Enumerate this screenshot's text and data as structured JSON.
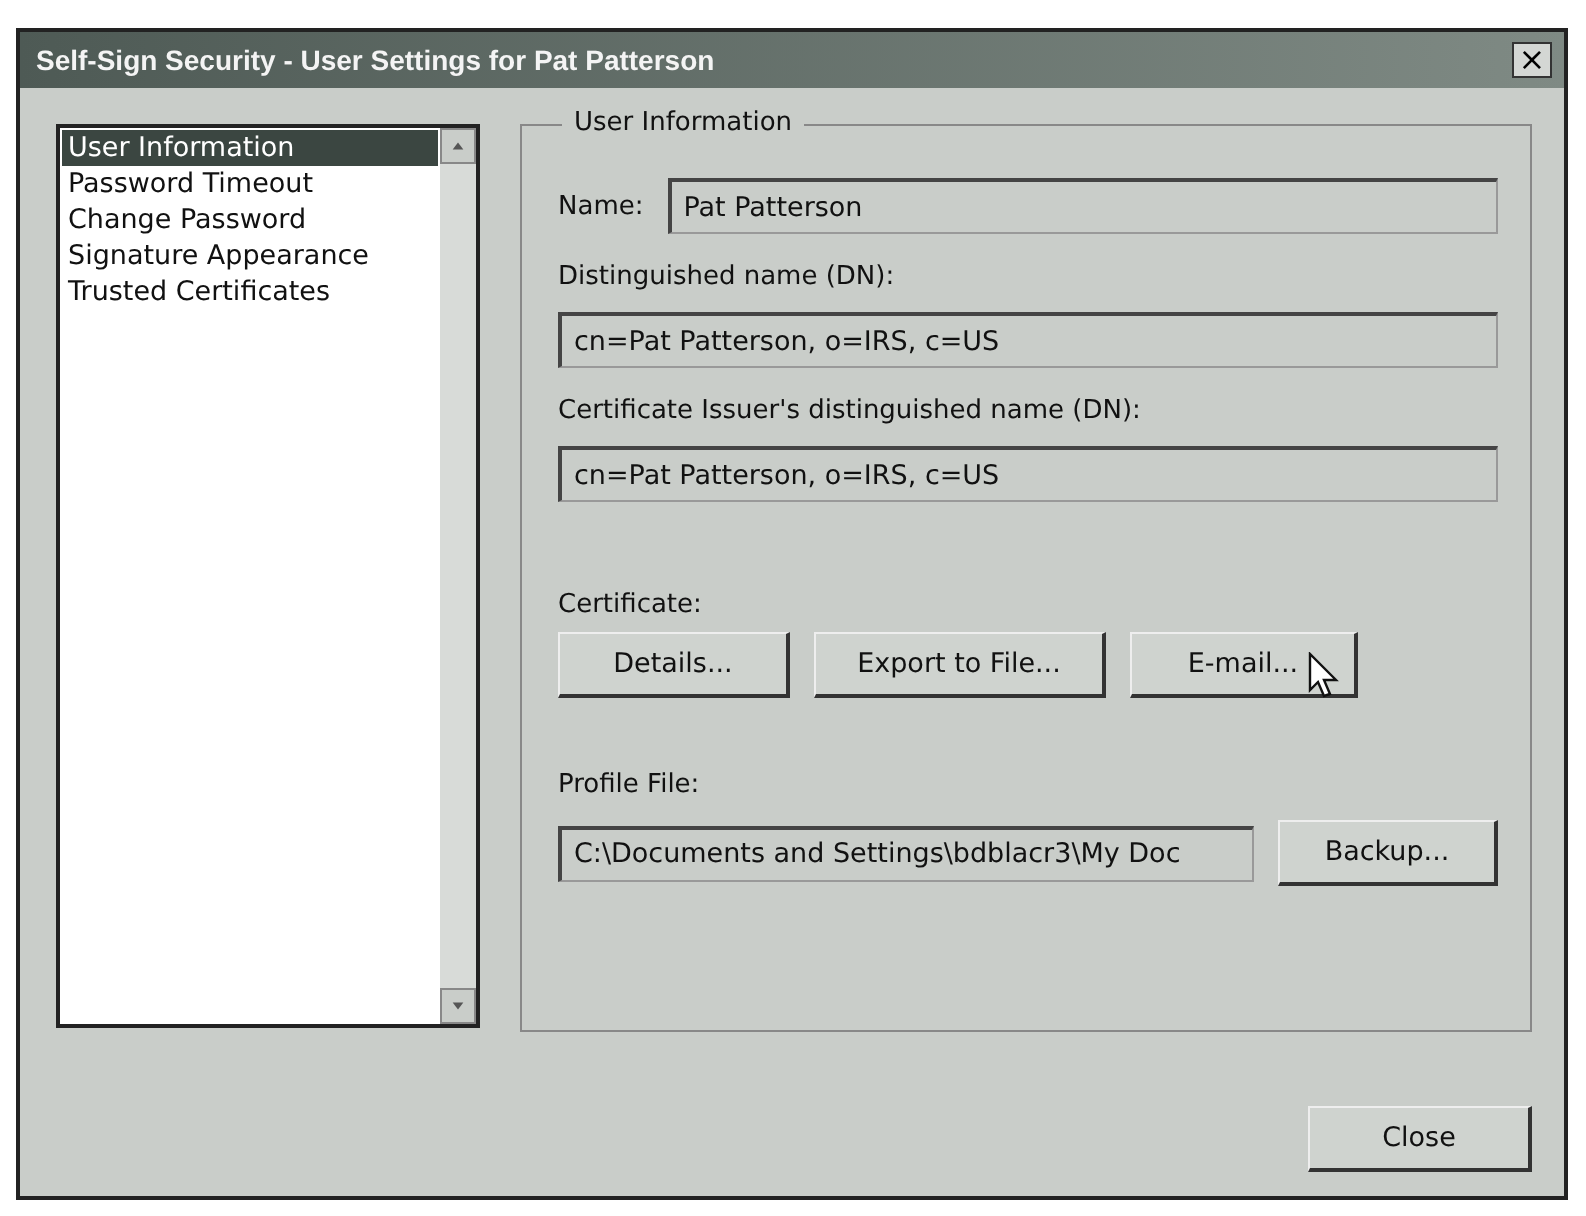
{
  "window": {
    "title": "Self-Sign Security - User Settings for Pat Patterson",
    "close_glyph": "×"
  },
  "sidebar": {
    "items": [
      {
        "label": "User Information",
        "selected": true
      },
      {
        "label": "Password Timeout",
        "selected": false
      },
      {
        "label": "Change Password",
        "selected": false
      },
      {
        "label": "Signature Appearance",
        "selected": false
      },
      {
        "label": "Trusted Certificates",
        "selected": false
      }
    ]
  },
  "group": {
    "title": "User Information",
    "name_label": "Name:",
    "name_value": "Pat Patterson",
    "dn_label": "Distinguished name (DN):",
    "dn_value": "cn=Pat Patterson, o=IRS, c=US",
    "issuer_label": "Certificate Issuer's distinguished name (DN):",
    "issuer_value": "cn=Pat Patterson, o=IRS, c=US",
    "certificate_label": "Certificate:",
    "certificate_buttons": [
      "Details...",
      "Export to File...",
      "E-mail..."
    ],
    "profile_label": "Profile File:",
    "profile_value": "C:\\Documents and Settings\\bdblacr3\\My Doc",
    "backup_button": "Backup..."
  },
  "buttons": [
    "Close"
  ]
}
